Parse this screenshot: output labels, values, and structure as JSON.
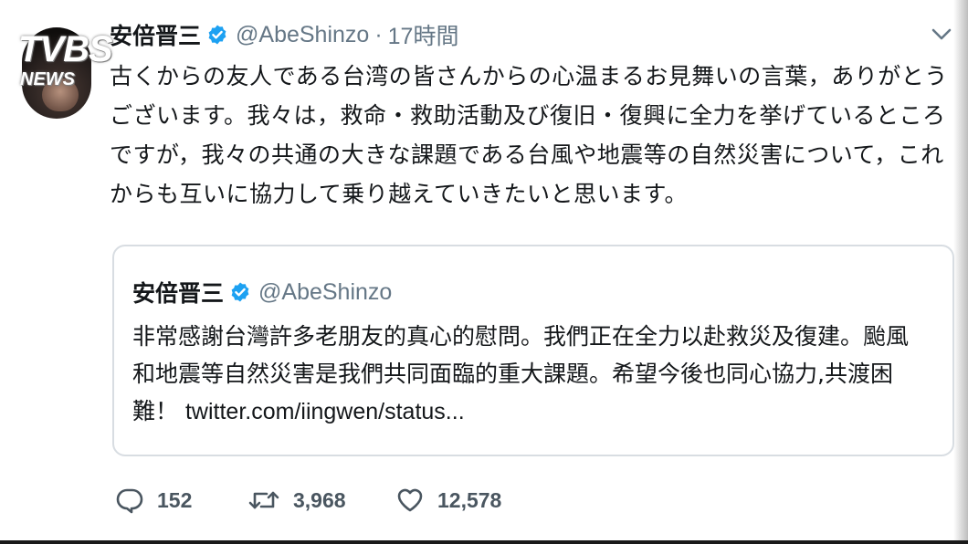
{
  "watermark": {
    "brand": "TVBS",
    "sub": "NEWS"
  },
  "tweet": {
    "author_name": "安倍晋三",
    "handle": "@AbeShinzo",
    "separator": "·",
    "time": "17時間",
    "text_lines": [
      "古くからの友人である台湾の皆さんからの心温まるお見舞いの言葉，ありがとう",
      "ございます。我々は，救命・救助活動及び復旧・復興に全力を挙げているところ",
      "ですが，我々の共通の大きな課題である台風や地震等の自然災害について，これ",
      "からも互いに協力して乗り越えていきたいと思います。"
    ],
    "icons": {
      "verified": "verified-badge-icon",
      "menu": "chevron-down-icon"
    }
  },
  "quoted_tweet": {
    "author_name": "安倍晋三",
    "handle": "@AbeShinzo",
    "text_lines": [
      "非常感謝台灣許多老朋友的真心的慰問。我們正在全力以赴救災及復建。颱風",
      "和地震等自然災害是我們共同面臨的重大課題。希望今後也同心協力,共渡困"
    ],
    "text_line3": "難！",
    "link": "twitter.com/iingwen/status..."
  },
  "actions": {
    "replies": "152",
    "retweets": "3,968",
    "likes": "12,578"
  },
  "colors": {
    "verified_blue": "#1da1f2",
    "secondary_text": "#657786",
    "border": "#d8dde2"
  }
}
